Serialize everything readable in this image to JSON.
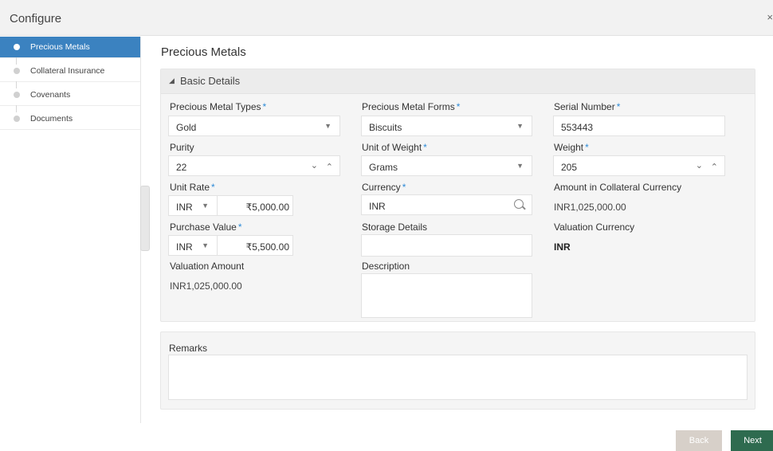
{
  "header": {
    "title": "Configure",
    "close": "×"
  },
  "sidebar": {
    "items": [
      {
        "label": "Precious Metals",
        "active": true
      },
      {
        "label": "Collateral Insurance",
        "active": false
      },
      {
        "label": "Covenants",
        "active": false
      },
      {
        "label": "Documents",
        "active": false
      }
    ]
  },
  "main": {
    "title": "Precious Metals"
  },
  "basic": {
    "title": "Basic Details",
    "metal_types": {
      "label": "Precious Metal Types",
      "value": "Gold"
    },
    "metal_forms": {
      "label": "Precious Metal Forms",
      "value": "Biscuits"
    },
    "serial": {
      "label": "Serial Number",
      "value": "553443"
    },
    "purity": {
      "label": "Purity",
      "value": "22"
    },
    "unit_weight": {
      "label": "Unit of Weight",
      "value": "Grams"
    },
    "weight": {
      "label": "Weight",
      "value": "205"
    },
    "unit_rate": {
      "label": "Unit Rate",
      "currency": "INR",
      "value": "₹5,000.00"
    },
    "currency": {
      "label": "Currency",
      "value": "INR"
    },
    "amount_collateral": {
      "label": "Amount in Collateral Currency",
      "value": "INR1,025,000.00"
    },
    "purchase_value": {
      "label": "Purchase Value",
      "currency": "INR",
      "value": "₹5,500.00"
    },
    "storage": {
      "label": "Storage Details",
      "value": ""
    },
    "valuation_currency": {
      "label": "Valuation Currency",
      "value": "INR"
    },
    "valuation_amount": {
      "label": "Valuation Amount",
      "value": "INR1,025,000.00"
    },
    "description": {
      "label": "Description",
      "value": ""
    },
    "required_mark": "*"
  },
  "remarks": {
    "label": "Remarks",
    "value": ""
  },
  "footer": {
    "back": "Back",
    "next": "Next"
  },
  "colors": {
    "accent": "#3b82c0",
    "next": "#2e6b4f",
    "back": "#d7d0c9",
    "required": "#2e8bd7"
  }
}
